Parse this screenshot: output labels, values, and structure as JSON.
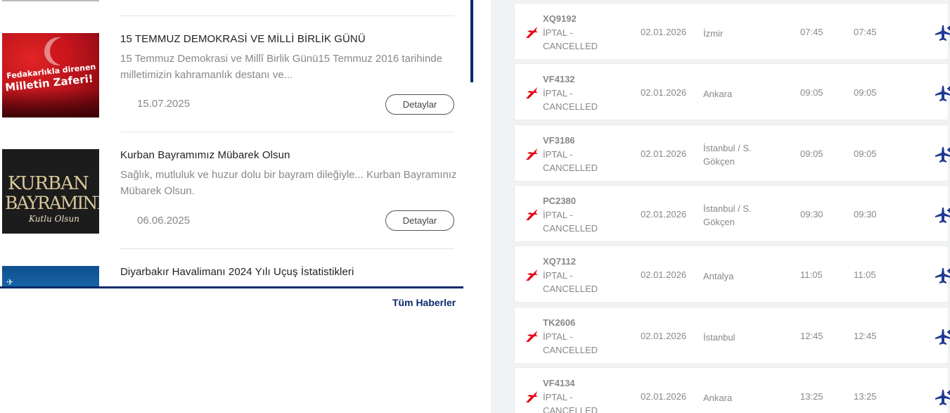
{
  "news": {
    "items": [
      {
        "title": "15 TEMMUZ DEMOKRASİ VE MİLLİ BİRLİK GÜNÜ",
        "excerpt": "15 Temmuz Demokrasi ve Millî Birlik Günü15 Temmuz 2016 tarihinde milletimizin kahramanlık destanı ve...",
        "date": "15.07.2025",
        "button_label": "Detaylar",
        "thumb_line1": "Fedakarlıkla direnen",
        "thumb_line2": "Milletin Zaferi!"
      },
      {
        "title": "Kurban Bayramımız Mübarek Olsun",
        "excerpt": "Sağlık, mutluluk ve huzur dolu bir bayram dileğiyle... Kurban Bayramınız Mübarek Olsun.",
        "date": "06.06.2025",
        "button_label": "Detaylar",
        "thumb_line1": "KURBAN",
        "thumb_line2": "BAYRAMINIZ",
        "thumb_line3": "Kutlu Olsun"
      },
      {
        "title": "Diyarbakır Havalimanı 2024 Yılı Uçuş İstatistikleri"
      }
    ],
    "all_news_label": "Tüm Haberler"
  },
  "flights": {
    "rows": [
      {
        "code": "XQ9192",
        "status1": "İPTAL -",
        "status2": "CANCELLED",
        "date": "02.01.2026",
        "city": "İzmir",
        "city2": "",
        "scheduled": "07:45",
        "estimated": "07:45"
      },
      {
        "code": "VF4132",
        "status1": "İPTAL -",
        "status2": "CANCELLED",
        "date": "02.01.2026",
        "city": "Ankara",
        "city2": "",
        "scheduled": "09:05",
        "estimated": "09:05"
      },
      {
        "code": "VF3186",
        "status1": "İPTAL -",
        "status2": "CANCELLED",
        "date": "02.01.2026",
        "city": "İstanbul / S.",
        "city2": "Gökçen",
        "scheduled": "09:05",
        "estimated": "09:05"
      },
      {
        "code": "PC2380",
        "status1": "İPTAL -",
        "status2": "CANCELLED",
        "date": "02.01.2026",
        "city": "İstanbul / S.",
        "city2": "Gökçen",
        "scheduled": "09:30",
        "estimated": "09:30"
      },
      {
        "code": "XQ7112",
        "status1": "İPTAL -",
        "status2": "CANCELLED",
        "date": "02.01.2026",
        "city": "Antalya",
        "city2": "",
        "scheduled": "11:05",
        "estimated": "11:05"
      },
      {
        "code": "TK2606",
        "status1": "İPTAL -",
        "status2": "CANCELLED",
        "date": "02.01.2026",
        "city": "İstanbul",
        "city2": "",
        "scheduled": "12:45",
        "estimated": "12:45"
      },
      {
        "code": "VF4134",
        "status1": "İPTAL -",
        "status2": "CANCELLED",
        "date": "02.01.2026",
        "city": "Ankara",
        "city2": "",
        "scheduled": "13:25",
        "estimated": "13:25"
      }
    ],
    "airline_logo_icon": "airline-tail-logo-icon",
    "flight_type_icon": "departing-plane-icon",
    "colors": {
      "airline_red": "#e30a17",
      "plane_navy": "#1f3a93",
      "accent_navy": "#0b2a6b"
    }
  }
}
